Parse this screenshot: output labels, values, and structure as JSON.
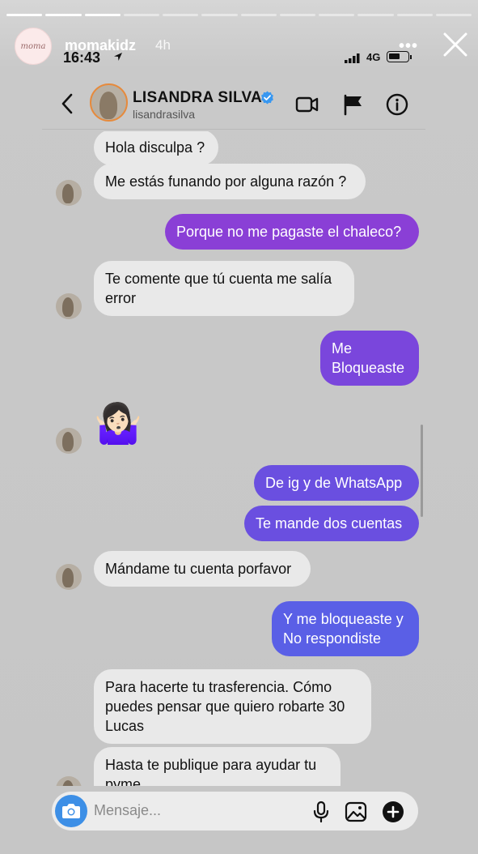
{
  "story": {
    "username": "momakidz",
    "time": "4h",
    "logo_text": "moma",
    "progress": [
      true,
      true,
      true,
      false,
      false,
      false,
      false,
      false,
      false,
      false,
      false,
      false
    ],
    "more_icon": "more-horizontal-icon",
    "close_icon": "close-icon"
  },
  "status_bar": {
    "time": "16:43",
    "network": "4G",
    "location_icon": "location-arrow-icon",
    "signal_icon": "signal-bars-icon",
    "battery_icon": "battery-icon"
  },
  "header": {
    "name": "LISANDRA SILVA",
    "username": "lisandrasilva",
    "verified": true,
    "icons": [
      "back-chevron-icon",
      "video-call-icon",
      "flag-icon",
      "info-icon"
    ]
  },
  "colors": {
    "incoming_bubble": "#e9e9e9",
    "outgoing_gradient": [
      "#8a3fd6",
      "#5a5fe6",
      "#4d70e6"
    ],
    "camera_button": "#3d8fe6",
    "verified": "#3897f0"
  },
  "messages": [
    {
      "from": "them",
      "text": "Hola disculpa ?"
    },
    {
      "from": "them",
      "text": "Me estás funando por alguna razón ?"
    },
    {
      "from": "me",
      "text": "Porque no me pagaste el chaleco?"
    },
    {
      "from": "them",
      "text": "Te comente que tú cuenta me salía\nerror"
    },
    {
      "from": "me",
      "text": "Me\nBloqueaste"
    },
    {
      "from": "them",
      "text": "🤷🏻‍♀️",
      "type": "emoji"
    },
    {
      "from": "me",
      "text": "De ig y de WhatsApp"
    },
    {
      "from": "me",
      "text": "Te mande dos cuentas"
    },
    {
      "from": "them",
      "text": "Mándame tu cuenta porfavor"
    },
    {
      "from": "me",
      "text": "Y me bloqueaste y\nNo respondiste"
    },
    {
      "from": "them",
      "text": "Para hacerte tu trasferencia. Cómo\npuedes pensar que quiero robarte 30\nLucas"
    },
    {
      "from": "them",
      "text": "Hasta te publique para ayudar tu\npyme"
    }
  ],
  "composer": {
    "placeholder": "Mensaje...",
    "icons": [
      "camera-icon",
      "microphone-icon",
      "gallery-icon",
      "add-icon"
    ]
  }
}
